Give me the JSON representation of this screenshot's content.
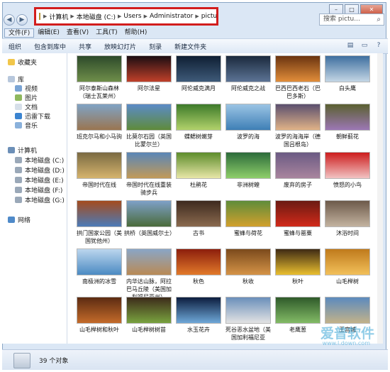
{
  "search": {
    "placeholder": "搜索 pictu..."
  },
  "breadcrumb": [
    "计算机",
    "本地磁盘 (C:)",
    "Users",
    "Administrator",
    "pictures"
  ],
  "menu": [
    "文件(F)",
    "编辑(E)",
    "查看(V)",
    "工具(T)",
    "帮助(H)"
  ],
  "toolbar": [
    "组织",
    "包含到库中",
    "共享",
    "放映幻灯片",
    "刻录",
    "新建文件夹"
  ],
  "nav": {
    "favorites": "收藏夹",
    "library": "库",
    "videos": "视频",
    "pictures": "图片",
    "documents": "文档",
    "thunder": "迅雷下载",
    "music": "音乐",
    "computer": "计算机",
    "drives": [
      "本地磁盘 (C:)",
      "本地磁盘 (D:)",
      "本地磁盘 (E:)",
      "本地磁盘 (F:)",
      "本地磁盘 (G:)"
    ],
    "network": "网络"
  },
  "files": [
    {
      "name": "阿尔泰斯山森林（瑞士瓦莱州）",
      "colors": [
        "#2d4a2a",
        "#6f8e4a"
      ]
    },
    {
      "name": "阿尔法星",
      "colors": [
        "#1b0d12",
        "#c0402a"
      ]
    },
    {
      "name": "阿伦威克满月",
      "colors": [
        "#0f1f33",
        "#3e5a79"
      ]
    },
    {
      "name": "阿伦威克之战",
      "colors": [
        "#1b2a3d",
        "#5c7395"
      ]
    },
    {
      "name": "巴西巴西老石（巴巴多斯）",
      "colors": [
        "#6a3410",
        "#e28e3a"
      ]
    },
    {
      "name": "白头鹰",
      "colors": [
        "#3e6f9f",
        "#c4d6e5"
      ]
    },
    {
      "name": "班克尔马和小马驹",
      "colors": [
        "#7fa3c5",
        "#9a7550"
      ]
    },
    {
      "name": "比莫尔石园（英国比蒙尔兰）",
      "colors": [
        "#5b8bc8",
        "#5f8b3a"
      ]
    },
    {
      "name": "蝶鳃树嫩芽",
      "colors": [
        "#3d7a2a",
        "#b2d26b"
      ]
    },
    {
      "name": "波罗的海",
      "colors": [
        "#9bc4e4",
        "#3e7fb6"
      ]
    },
    {
      "name": "波罗的海海岸（德国吕根岛）",
      "colors": [
        "#5b4f6e",
        "#e1b387"
      ]
    },
    {
      "name": "朝鲜蓟花",
      "colors": [
        "#5a6030",
        "#9c77b5"
      ]
    },
    {
      "name": "帝国时代在线",
      "colors": [
        "#7a6a42",
        "#d6b46d"
      ]
    },
    {
      "name": "帝国时代在线重装骑步兵",
      "colors": [
        "#5a86b7",
        "#c29a58"
      ]
    },
    {
      "name": "杜鹃花",
      "colors": [
        "#5d8c2b",
        "#e8e7a8"
      ]
    },
    {
      "name": "非洲树蝗",
      "colors": [
        "#2c6b3a",
        "#8fcf6a"
      ]
    },
    {
      "name": "废弃的房子",
      "colors": [
        "#6b5a83",
        "#a9859e"
      ]
    },
    {
      "name": "愤怒的小鸟",
      "colors": [
        "#cc1c1c",
        "#f2c3c3"
      ]
    },
    {
      "name": "拱门国家公园（美国犹他州）",
      "colors": [
        "#a44b1d",
        "#4b7bb8"
      ]
    },
    {
      "name": "拱桥（英国威尔士）",
      "colors": [
        "#7ea0c8",
        "#4a6b3a"
      ]
    },
    {
      "name": "古书",
      "colors": [
        "#3e2a1f",
        "#8a6a4f"
      ]
    },
    {
      "name": "蜜蜂与荷花",
      "colors": [
        "#5f8c3a",
        "#d2a02d"
      ]
    },
    {
      "name": "蜜蜂与罂粟",
      "colors": [
        "#6b1a12",
        "#d22a1a"
      ]
    },
    {
      "name": "沐浴时间",
      "colors": [
        "#6d5a4a",
        "#c3b3a0"
      ]
    },
    {
      "name": "南极洲的冰雪",
      "colors": [
        "#bcd6ee",
        "#4b8ac2"
      ]
    },
    {
      "name": "内华达山脉，阿拉巴马丘陵（美国加利福尼亚州）",
      "colors": [
        "#8aa6c6",
        "#b98a55"
      ]
    },
    {
      "name": "秋色",
      "colors": [
        "#8c1e0c",
        "#e27a2a"
      ]
    },
    {
      "name": "秋收",
      "colors": [
        "#7b4a1c",
        "#d59347"
      ]
    },
    {
      "name": "秋叶",
      "colors": [
        "#3e2a14",
        "#eabf2f"
      ]
    },
    {
      "name": "山毛榉树",
      "colors": [
        "#bf7a1c",
        "#f2c05a"
      ]
    },
    {
      "name": "山毛榉树和秋叶",
      "colors": [
        "#5c2b12",
        "#c46b2a"
      ]
    },
    {
      "name": "山毛榉树树苗",
      "colors": [
        "#3d2b1a",
        "#79a33f"
      ]
    },
    {
      "name": "水玉花卉",
      "colors": [
        "#0c1d3e",
        "#6fa8d8"
      ]
    },
    {
      "name": "死谷恶水盆地（美国加利福尼亚",
      "colors": [
        "#6a8fba",
        "#e3e3e3"
      ]
    },
    {
      "name": "老鹰葱",
      "colors": [
        "#2f5a2a",
        "#83bb66"
      ]
    },
    {
      "name": "王宫城",
      "colors": [
        "#5c8abe",
        "#c2b28a"
      ]
    }
  ],
  "status": {
    "count": "39 个对象"
  },
  "watermark": {
    "text": "爱普软件",
    "url": "www.l.down.com"
  }
}
